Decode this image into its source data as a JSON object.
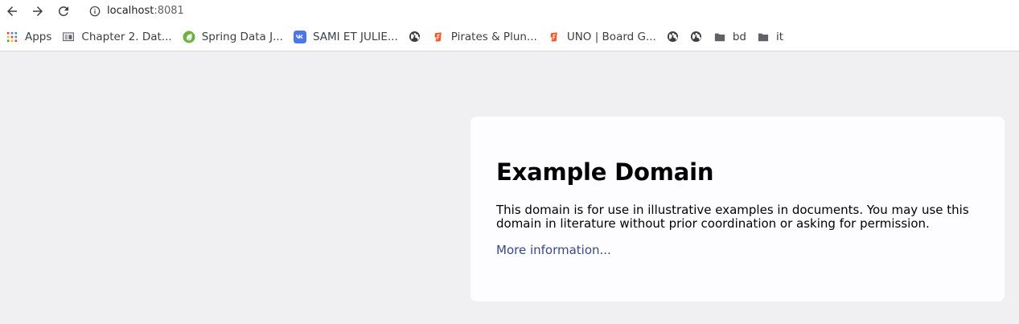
{
  "browser": {
    "url_host": "localhost",
    "url_port": ":8081"
  },
  "bookmarks": [
    {
      "label": "Apps",
      "icon": "apps-grid-icon"
    },
    {
      "label": "Chapter 2. Dat...",
      "icon": "document-icon"
    },
    {
      "label": "Spring Data J...",
      "icon": "spring-leaf-icon"
    },
    {
      "label": "SAMI ET JULIE...",
      "icon": "vk-icon"
    },
    {
      "label": "",
      "icon": "globe-icon"
    },
    {
      "label": "Pirates & Plun...",
      "icon": "board-game-icon"
    },
    {
      "label": "UNO | Board G...",
      "icon": "board-game-icon"
    },
    {
      "label": "",
      "icon": "globe-icon"
    },
    {
      "label": "",
      "icon": "globe-icon"
    },
    {
      "label": "bd",
      "icon": "folder-icon"
    },
    {
      "label": "it",
      "icon": "folder-icon"
    }
  ],
  "page": {
    "heading": "Example Domain",
    "paragraph": "This domain is for use in illustrative examples in documents. You may use this domain in literature without prior coordination or asking for permission.",
    "link": "More information..."
  },
  "colors": {
    "page_background": "#f0f0f2",
    "card_background": "#fdfdff",
    "link": "#38488f",
    "spring_green": "#6db33f",
    "vk_blue": "#4c75f2",
    "game_red": "#ff4f1f"
  }
}
